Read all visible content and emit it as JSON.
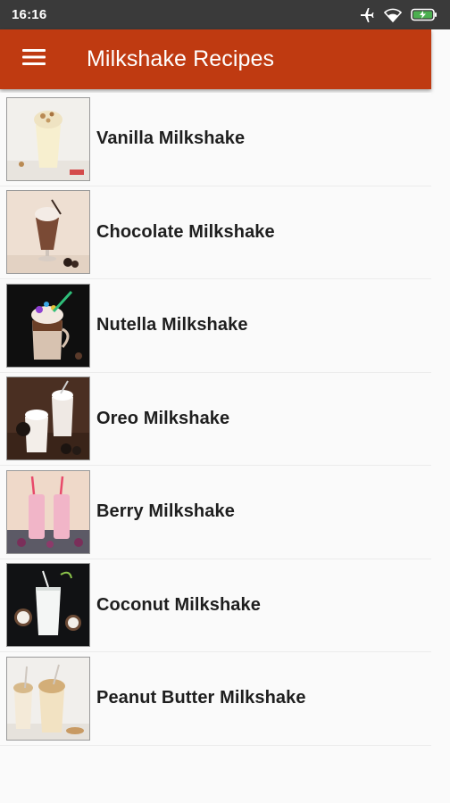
{
  "status_bar": {
    "time": "16:16",
    "icons": [
      "airplane-icon",
      "wifi-icon",
      "battery-charging-icon"
    ]
  },
  "app_bar": {
    "title": "Milkshake Recipes",
    "menu_icon": "hamburger-menu-icon",
    "color": "#bf3a11"
  },
  "recipes": [
    {
      "label": "Vanilla Milkshake"
    },
    {
      "label": "Chocolate Milkshake"
    },
    {
      "label": "Nutella Milkshake"
    },
    {
      "label": "Oreo Milkshake"
    },
    {
      "label": "Berry Milkshake"
    },
    {
      "label": "Coconut Milkshake"
    },
    {
      "label": "Peanut Butter Milkshake"
    }
  ]
}
